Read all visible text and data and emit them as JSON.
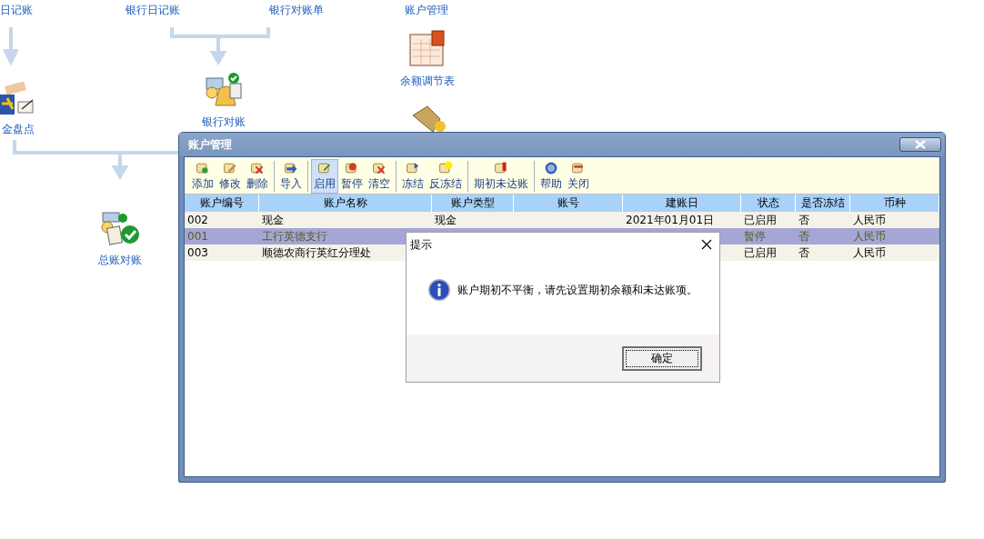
{
  "canvas": {
    "nodes": [
      {
        "label": "日记账"
      },
      {
        "label": "银行日记账"
      },
      {
        "label": "银行对账单"
      },
      {
        "label": "账户管理"
      },
      {
        "label": "余额调节表"
      },
      {
        "label": "金盘点"
      },
      {
        "label": "银行对账"
      },
      {
        "label": "总账对账"
      }
    ]
  },
  "window": {
    "title": "账户管理",
    "toolbar": [
      [
        {
          "label": "添加",
          "selected": false
        },
        {
          "label": "修改",
          "selected": false
        },
        {
          "label": "删除",
          "selected": false
        }
      ],
      [
        {
          "label": "导入",
          "selected": false
        }
      ],
      [
        {
          "label": "启用",
          "selected": true
        },
        {
          "label": "暂停",
          "selected": false
        },
        {
          "label": "清空",
          "selected": false
        }
      ],
      [
        {
          "label": "冻结",
          "selected": false
        },
        {
          "label": "反冻结",
          "selected": false
        }
      ],
      [
        {
          "label": "期初未达账",
          "selected": false
        }
      ],
      [
        {
          "label": "帮助",
          "selected": false
        },
        {
          "label": "关闭",
          "selected": false
        }
      ]
    ],
    "table": {
      "columns": [
        "账户编号",
        "账户名称",
        "账户类型",
        "账号",
        "建账日",
        "状态",
        "是否冻结",
        "币种"
      ],
      "rows": [
        {
          "selected": false,
          "cells": [
            "002",
            "现金",
            "现金",
            "",
            "2021年01月01日",
            "已启用",
            "否",
            "人民币"
          ]
        },
        {
          "selected": true,
          "cells": [
            "001",
            "工行英德支行",
            "",
            "",
            "",
            "暂停",
            "否",
            "人民币"
          ]
        },
        {
          "selected": false,
          "cells": [
            "003",
            "顺德农商行英红分理处",
            "",
            "",
            "",
            "已启用",
            "否",
            "人民币"
          ]
        }
      ]
    }
  },
  "dialog": {
    "title": "提示",
    "message": "账户期初不平衡，请先设置期初余额和未达账项。",
    "button": "确定"
  }
}
